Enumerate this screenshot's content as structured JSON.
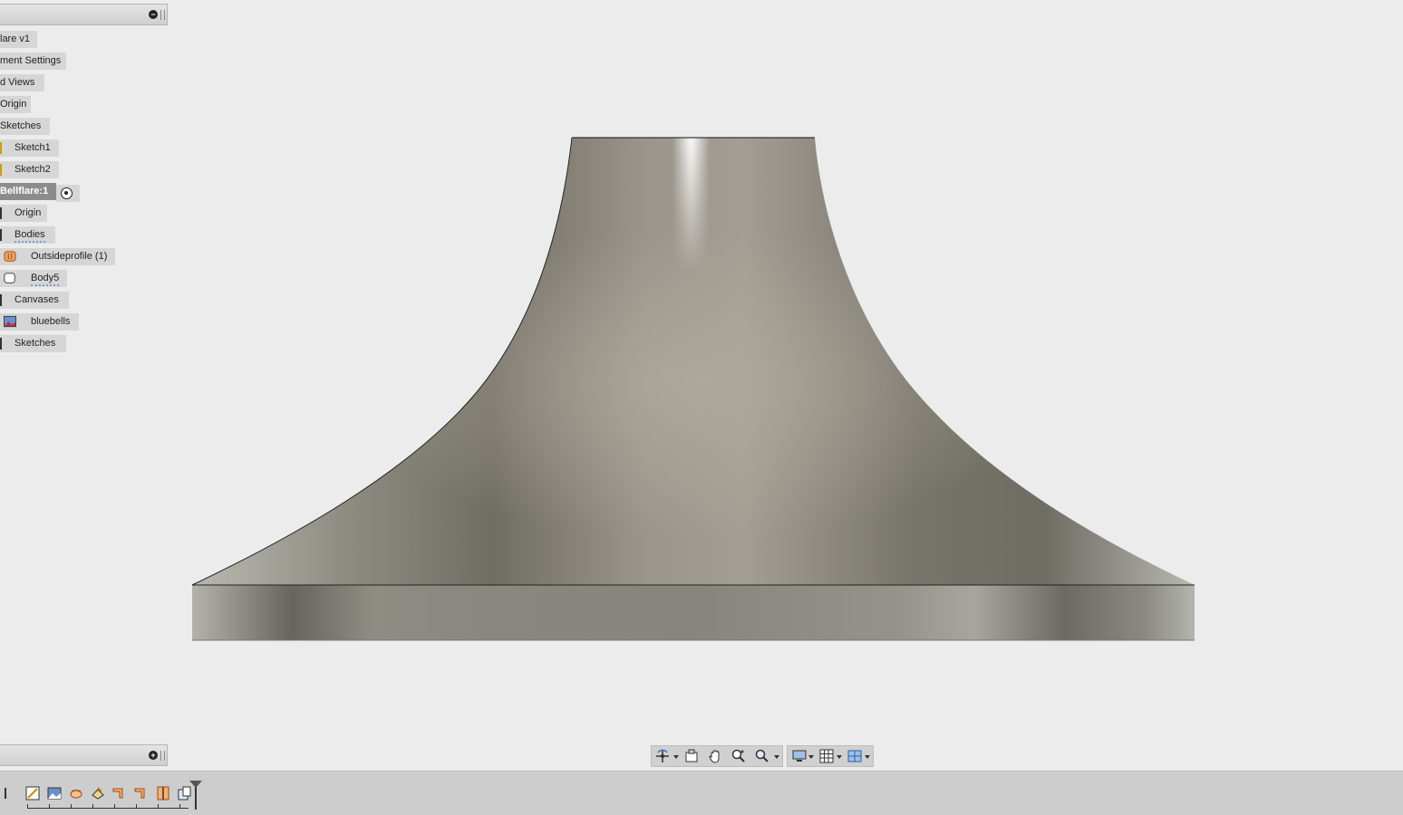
{
  "browser": {
    "items": [
      {
        "label": "lare v1"
      },
      {
        "label": "ment Settings"
      },
      {
        "label": "d Views"
      },
      {
        "label": "Origin"
      },
      {
        "label": "Sketches"
      },
      {
        "label": "Sketch1"
      },
      {
        "label": "Sketch2"
      },
      {
        "label": "Bellflare:1"
      },
      {
        "label": "Origin"
      },
      {
        "label": "Bodies"
      },
      {
        "label": "Outsideprofile (1)"
      },
      {
        "label": "Body5"
      },
      {
        "label": "Canvases"
      },
      {
        "label": "bluebells"
      },
      {
        "label": "Sketches"
      }
    ],
    "collapse_symbol": "−",
    "expand_symbol": "+"
  },
  "colors": {
    "viewport_bg": "#ececec",
    "body_light": "#b9b7ae",
    "body_dark": "#6e6b62",
    "active_item": "#8c8c8c"
  },
  "nav_toolbar": {
    "icons": [
      "orbit-icon",
      "look-at-icon",
      "pan-icon",
      "zoom-icon",
      "fit-icon",
      "display-settings-icon",
      "grid-icon",
      "viewports-icon"
    ]
  },
  "timeline": {
    "features": [
      "sketch-icon",
      "canvas-icon",
      "revolve-icon",
      "sketch-icon",
      "extrude-icon",
      "extrude-icon",
      "split-icon",
      "body-icon"
    ]
  }
}
